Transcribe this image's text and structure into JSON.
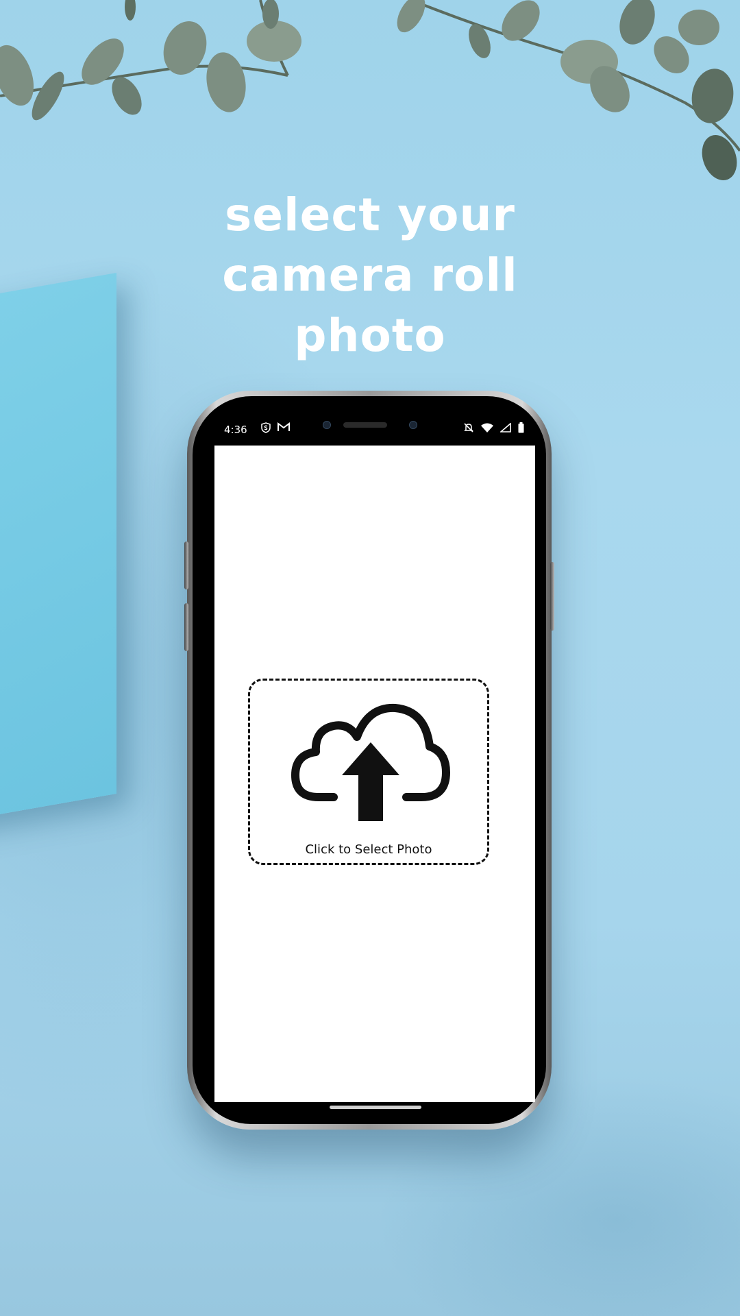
{
  "headline": {
    "line1": "select your",
    "line2": "camera roll",
    "line3": "photo"
  },
  "status_bar": {
    "time": "4:36",
    "left_icons": [
      "shield-s-icon",
      "gmail-icon"
    ],
    "right_icons": [
      "notifications-off-icon",
      "wifi-icon",
      "signal-icon",
      "battery-icon"
    ]
  },
  "upload": {
    "icon": "cloud-upload-icon",
    "label": "Click to Select Photo"
  },
  "colors": {
    "background": "#a6d5ec",
    "headline_text": "#ffffff",
    "screen": "#ffffff",
    "dashed_border": "#111111"
  }
}
